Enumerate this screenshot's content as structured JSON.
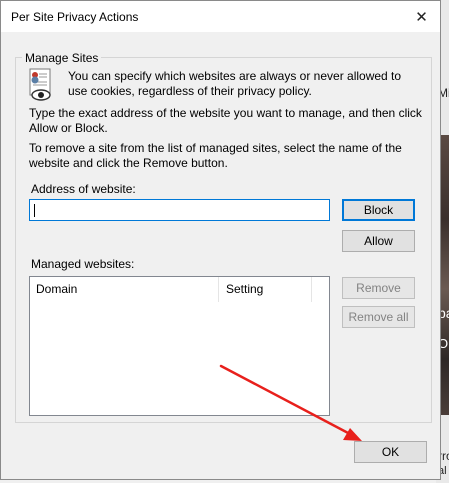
{
  "dialog": {
    "title": "Per Site Privacy Actions",
    "close_glyph": "✕"
  },
  "group": {
    "label": "Manage Sites",
    "intro": "You can specify which websites are always or never allowed to use cookies, regardless of their privacy policy.",
    "instruction_1": "Type the exact address of the website you want to manage, and then click Allow or Block.",
    "instruction_2": "To remove a site from the list of managed sites, select the name of the website and click the Remove button."
  },
  "address": {
    "label": "Address of website:",
    "value": ""
  },
  "buttons": {
    "block": "Block",
    "allow": "Allow",
    "remove": "Remove",
    "remove_all": "Remove all",
    "ok": "OK"
  },
  "managed": {
    "label": "Managed websites:",
    "columns": [
      "Domain",
      "Setting"
    ],
    "rows": []
  },
  "background": {
    "snippets": [
      "Mi",
      "pa",
      "On",
      "rro",
      "al how"
    ]
  },
  "colors": {
    "annotation_arrow": "#e8201c",
    "focus_blue": "#0078d7"
  },
  "icons": {
    "privacy": "privacy-policy-icon",
    "close": "close-icon"
  }
}
